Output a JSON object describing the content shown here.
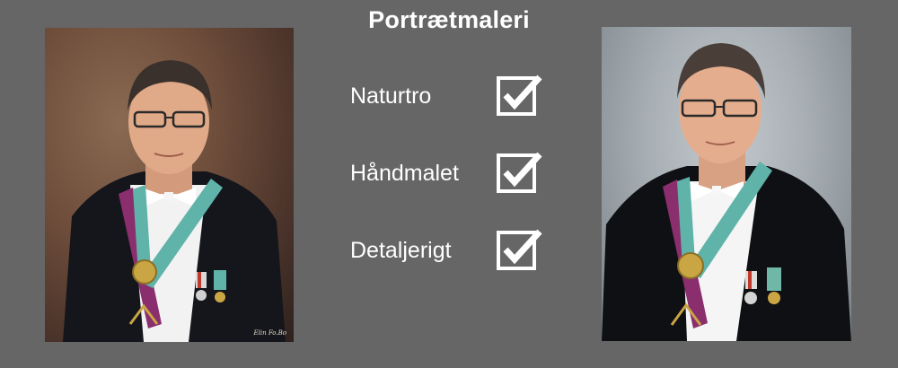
{
  "title": "Portrætmaleri",
  "features": [
    {
      "label": "Naturtro",
      "icon": "checkbox-checked-icon"
    },
    {
      "label": "Håndmalet",
      "icon": "checkbox-checked-icon"
    },
    {
      "label": "Detaljerigt",
      "icon": "checkbox-checked-icon"
    }
  ],
  "painting": {
    "signature": "Elin Fo.Bo"
  },
  "colors": {
    "background": "#666666",
    "text": "#ffffff",
    "painting_background": "#6e4d3b",
    "photo_background": "#a8afb4",
    "sash_teal": "#5fb3a9",
    "sash_purple": "#8a2e6e"
  }
}
